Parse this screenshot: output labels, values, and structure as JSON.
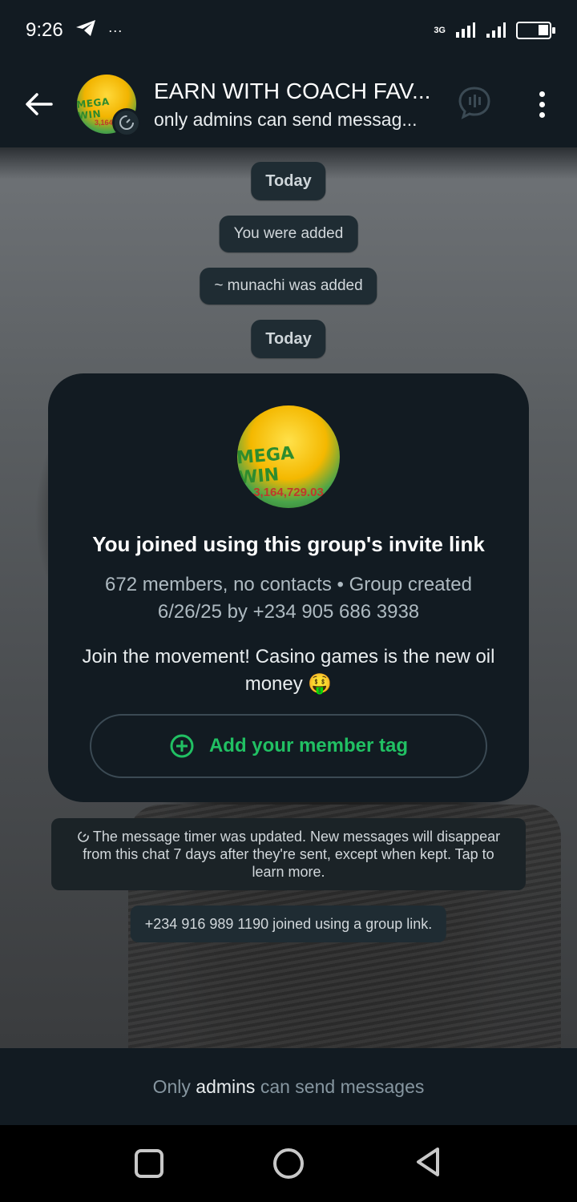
{
  "status_bar": {
    "time": "9:26",
    "ellipsis": "···",
    "network_type": "3G",
    "icons": [
      "telegram-icon",
      "signal-icon",
      "battery-icon"
    ]
  },
  "header": {
    "title": "EARN WITH COACH FAV...",
    "subtitle": "only admins can send messag...",
    "avatar_text": "MEGA WIN",
    "avatar_amount": "3,164,7",
    "icons": [
      "back-arrow-icon",
      "disappearing-timer-icon",
      "voice-chat-icon",
      "more-vert-icon"
    ]
  },
  "chat": {
    "date_label_1": "Today",
    "system_1": "You were added",
    "system_2": "~ munachi was added",
    "date_label_2": "Today",
    "group_card": {
      "avatar_text": "MEGA WIN",
      "avatar_amount": "3,164,729.03",
      "title": "You joined using this group's invite link",
      "meta": "672 members, no contacts • Group created 6/26/25 by +234 905 686 3938",
      "description": "Join the movement! Casino games is the new oil money 🤑",
      "member_tag_button": "Add your member tag"
    },
    "timer_notice": "The message timer was updated. New messages will disappear from this chat 7 days after they're sent, except when kept. Tap to learn more.",
    "join_notice": "+234 916 989 1190 joined using a group link."
  },
  "footer": {
    "prefix": "Only",
    "emphasis": "admins",
    "suffix": "can send messages"
  },
  "colors": {
    "accent_green": "#21c063",
    "header_bg": "#121b22",
    "bubble_bg": "#1f2c33"
  }
}
